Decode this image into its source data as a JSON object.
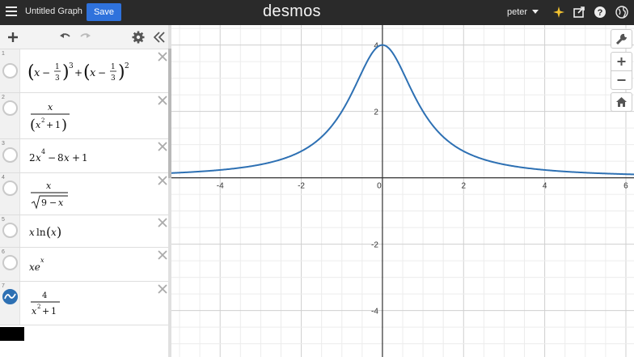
{
  "header": {
    "graph_title": "Untitled Graph",
    "save_label": "Save",
    "logo_text": "desmos",
    "user_name": "peter"
  },
  "expressions": [
    {
      "index": "1",
      "enabled": false
    },
    {
      "index": "2",
      "enabled": false
    },
    {
      "index": "3",
      "enabled": false
    },
    {
      "index": "4",
      "enabled": false
    },
    {
      "index": "5",
      "enabled": false
    },
    {
      "index": "6",
      "enabled": false
    },
    {
      "index": "7",
      "enabled": true
    }
  ],
  "graph": {
    "x_ticks": [
      "-4",
      "-2",
      "0",
      "2",
      "4",
      "6"
    ],
    "y_ticks": [
      "4",
      "2",
      "-2",
      "-4"
    ],
    "xlim": [
      -5.2,
      6.2
    ],
    "ylim": [
      -5.4,
      4.6
    ],
    "curve_color": "#2d70b3",
    "plotted_expression": "4 / (x^2 + 1)"
  }
}
